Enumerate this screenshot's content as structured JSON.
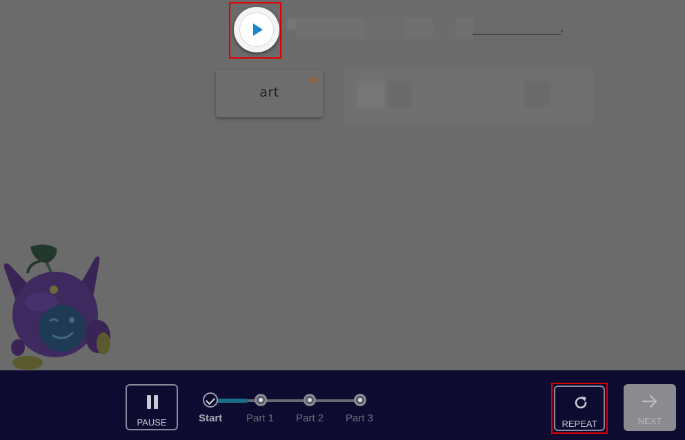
{
  "prompt": {
    "play_icon": "play-icon",
    "period": "."
  },
  "word_card": {
    "word": "art",
    "speaker_icon": "speaker-icon"
  },
  "controls": {
    "pause_label": "PAUSE",
    "repeat_label": "REPEAT",
    "next_label": "NEXT"
  },
  "progress": {
    "steps": [
      "Start",
      "Part 1",
      "Part 2",
      "Part 3"
    ],
    "current_step": 0
  },
  "colors": {
    "overlay_gray": "#6b6b6b",
    "bottom_bar": "#0d0b30",
    "play_accent": "#1a86c8",
    "highlight_red": "#e00000",
    "progress_fill": "#1a6e86"
  }
}
